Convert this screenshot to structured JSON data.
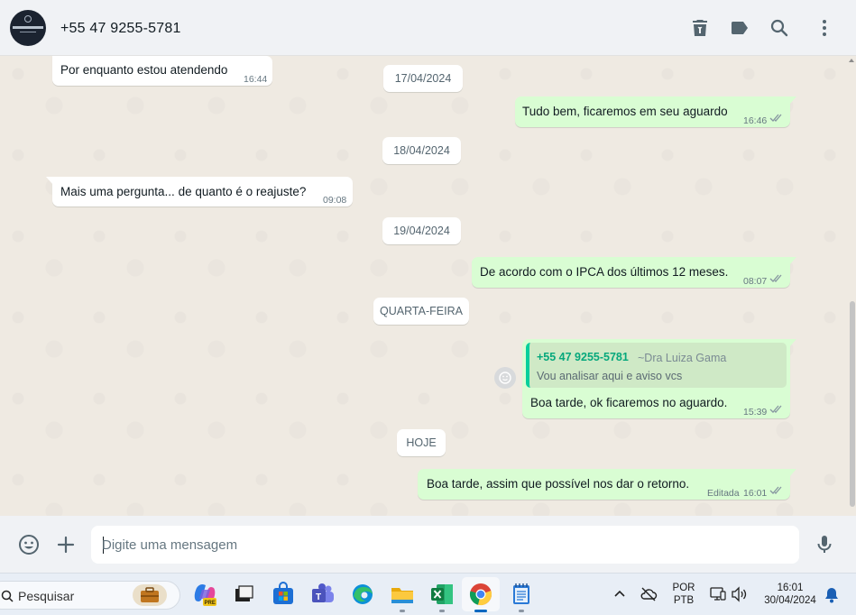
{
  "header": {
    "contact_name": "+55 47 9255-5781",
    "icons": [
      "trash-icon",
      "label-icon",
      "search-icon",
      "more-vertical-icon"
    ]
  },
  "messages": [
    {
      "direction": "in",
      "text": "Por enquanto estou atendendo",
      "time": "16:44"
    },
    {
      "type": "date",
      "label": "17/04/2024"
    },
    {
      "direction": "out",
      "text": "Tudo bem, ficaremos em seu aguardo",
      "time": "16:46",
      "status": "read"
    },
    {
      "type": "date",
      "label": "18/04/2024"
    },
    {
      "direction": "in",
      "text": "Mais uma pergunta... de quanto é o reajuste?",
      "time": "09:08"
    },
    {
      "type": "date",
      "label": "19/04/2024"
    },
    {
      "direction": "out",
      "text": "De acordo com o IPCA dos últimos 12 meses.",
      "time": "08:07",
      "status": "read"
    },
    {
      "type": "date",
      "label": "QUARTA-FEIRA"
    },
    {
      "direction": "out",
      "quote": {
        "author": "+55 47 9255-5781",
        "author_name": "~Dra Luiza Gama",
        "text": "Vou analisar aqui e aviso vcs"
      },
      "text": "Boa tarde, ok ficaremos no aguardo.",
      "time": "15:39",
      "status": "read"
    },
    {
      "type": "date",
      "label": "HOJE"
    },
    {
      "direction": "out",
      "text": "Boa tarde, assim que possível nos dar o retorno.",
      "edited": "Editada",
      "time": "16:01",
      "status": "read"
    }
  ],
  "composer": {
    "placeholder": "Digite uma mensagem",
    "icons": [
      "emoji-icon",
      "plus-icon",
      "microphone-icon"
    ]
  },
  "taskbar": {
    "search_label": "Pesquisar",
    "apps": [
      "briefcase",
      "copilot",
      "task-view",
      "microsoft-store",
      "teams",
      "edge",
      "file-explorer",
      "excel",
      "chrome",
      "notepad"
    ],
    "active_app": "chrome",
    "language": "POR",
    "layout": "PTB",
    "time": "16:01",
    "date": "30/04/2024"
  },
  "colors": {
    "chat_bg": "#efeae2",
    "outgoing_bubble": "#d9fdd3",
    "incoming_bubble": "#ffffff",
    "read_ticks": "#53bdeb",
    "quote_accent": "#06cf9c"
  }
}
